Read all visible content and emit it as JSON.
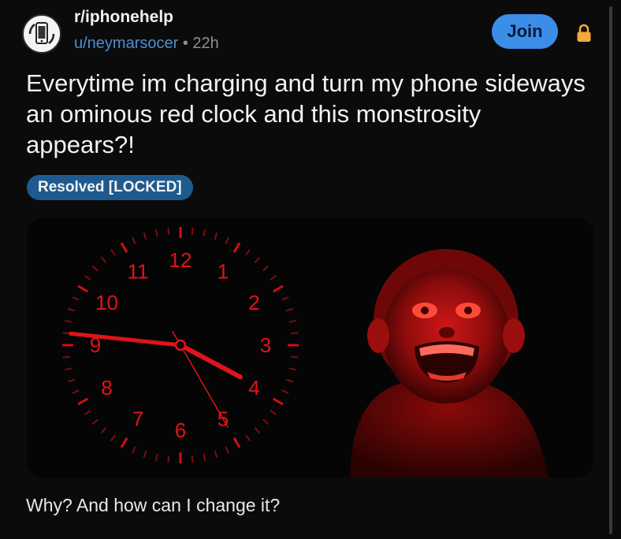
{
  "post": {
    "subreddit": "r/iphonehelp",
    "author": "u/neymarsocer",
    "separator": "•",
    "age": "22h",
    "join_label": "Join",
    "title": "Everytime im charging and turn my phone sideways an ominous red clock and this monstrosity appears?!",
    "flair": "Resolved [LOCKED]",
    "body": "Why? And how can I change it?"
  },
  "clock": {
    "numerals": [
      "12",
      "1",
      "2",
      "3",
      "4",
      "5",
      "6",
      "7",
      "8",
      "9",
      "10",
      "11"
    ],
    "color": "#e1131a"
  },
  "colors": {
    "background": "#0b0b0c",
    "accent": "#3a8ee8",
    "flair": "#1f5a8f",
    "username": "#4b8fd1",
    "lock": "#f2a93b"
  },
  "icons": {
    "subreddit": "phone-icon",
    "lock": "lock-icon"
  }
}
